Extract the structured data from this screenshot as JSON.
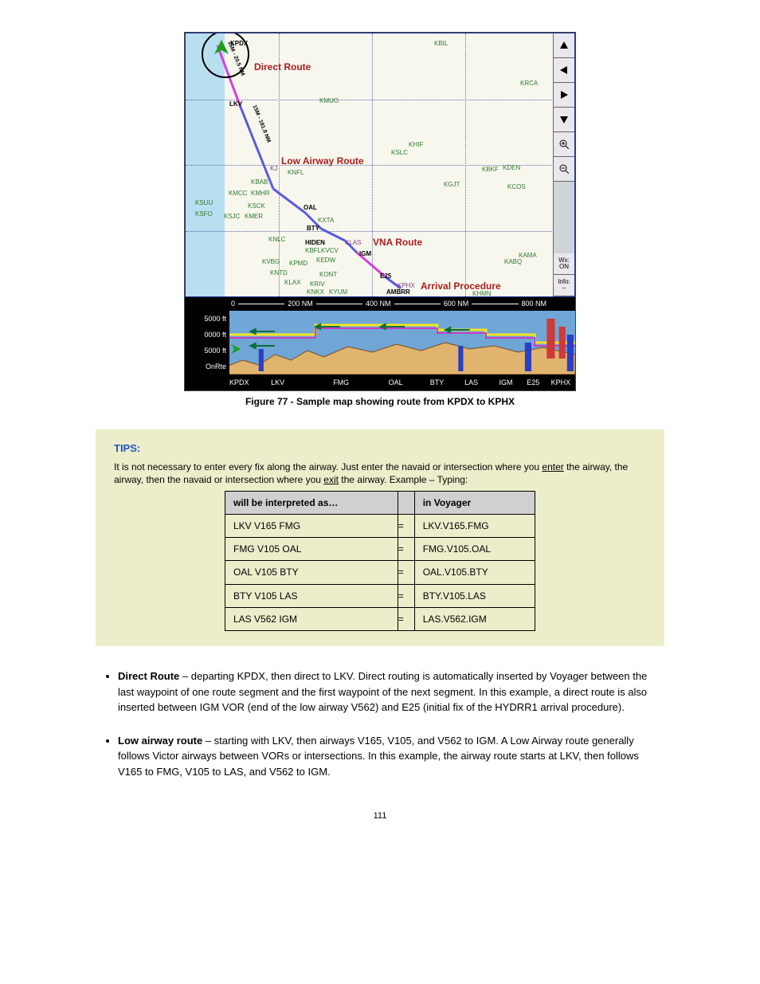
{
  "figure": {
    "caption": "Figure 77 - Sample map showing route from KPDX to KPHX",
    "map": {
      "labels": {
        "direct": "Direct Route",
        "lowairway": "Low Airway Route",
        "vna": "VNA Route",
        "arrival": "Arrival Procedure"
      },
      "controls": {
        "wx_label": "Wx:",
        "wx_value": "ON",
        "info_label": "Info:"
      },
      "waypoints": {
        "kpdx": "KPDX",
        "lkv": "LKV",
        "kmuo": "KMUO",
        "kbil": "KBIL",
        "krca": "KRCA",
        "khif": "KHIF",
        "kslc": "KSLC",
        "kgjt": "KGJT",
        "kbkf": "KBKF",
        "kden": "KDEN",
        "kcos": "KCOS",
        "kama": "KAMA",
        "kabq": "KABQ",
        "knfl": "KNFL",
        "kbab": "KBAB",
        "kmcc": "KMCC",
        "kmhr": "KMHR",
        "ksuu": "KSUU",
        "ksck": "KSCK",
        "ksfo": "KSFO",
        "ksjc": "KSJC",
        "kmer": "KMER",
        "knlc": "KNLC",
        "kvbg": "KVBG",
        "kpmd": "KPMD",
        "kntd": "KNTD",
        "klax": "KLAX",
        "kedw": "KEDW",
        "kont": "KONT",
        "kriv": "KRIV",
        "knkx": "KNKX",
        "kyum": "KYUM",
        "kvcv": "KVCV",
        "kbfl": "KBFL",
        "kxta": "KXTA",
        "klas": "KLAS",
        "khmn": "KHMN",
        "kphx": "KPHX",
        "kj": "KJ",
        "oal": "OAL",
        "bty": "BTY",
        "hiden": "HIDEN",
        "igm": "IGM",
        "e25": "E25",
        "ambrr": "AMBRR"
      },
      "route_legs": {
        "leg1": "15M - 20.5 NM",
        "leg2": "15M - 181.8 NM"
      },
      "scale": [
        "0",
        "200 NM",
        "400 NM",
        "600 NM",
        "800 NM"
      ]
    },
    "profile": {
      "y": [
        "5000 ft",
        "0000 ft",
        "5000 ft",
        "OnRte"
      ],
      "x": [
        "KPDX",
        "LKV",
        "FMG",
        "OAL",
        "BTY",
        "LAS",
        "IGM",
        "E25",
        "KPHX"
      ]
    }
  },
  "tip": {
    "title": "TIPS:",
    "intro_a": "It is not necessary to enter every fix along the airway. Just enter the navaid or intersection where you ",
    "intro_b": "enter",
    "intro_c": " the airway, the airway, then the navaid or intersection where you ",
    "intro_d": "exit",
    "intro_e": " the airway. Example – Typing:",
    "table": {
      "headers": [
        "will be interpreted as…",
        "",
        "in Voyager"
      ],
      "rows": [
        [
          "LKV V165 FMG",
          "=",
          "LKV.V165.FMG"
        ],
        [
          "FMG V105 OAL",
          "=",
          "FMG.V105.OAL"
        ],
        [
          "OAL V105 BTY",
          "=",
          "OAL.V105.BTY"
        ],
        [
          "BTY V105 LAS",
          "=",
          "BTY.V105.LAS"
        ],
        [
          "LAS V562 IGM",
          "=",
          "LAS.V562.IGM"
        ]
      ]
    }
  },
  "bullets": [
    {
      "lead": "Direct Route ",
      "body": "– departing KPDX, then direct to LKV. Direct routing is automatically inserted by Voyager between the last waypoint of one route segment and the first waypoint of the next segment. In this example, a direct route is also inserted between IGM VOR (end of the low airway V562) and E25 (initial fix of the HYDRR1 arrival procedure)."
    },
    {
      "lead": "Low airway route ",
      "body": "– starting with LKV, then airways V165, V105, and V562 to IGM. A Low Airway route generally follows Victor airways between VORs or intersections. In this example, the airway route starts at LKV, then follows V165 to FMG, V105 to LAS, and V562 to IGM."
    }
  ],
  "footer": "111"
}
